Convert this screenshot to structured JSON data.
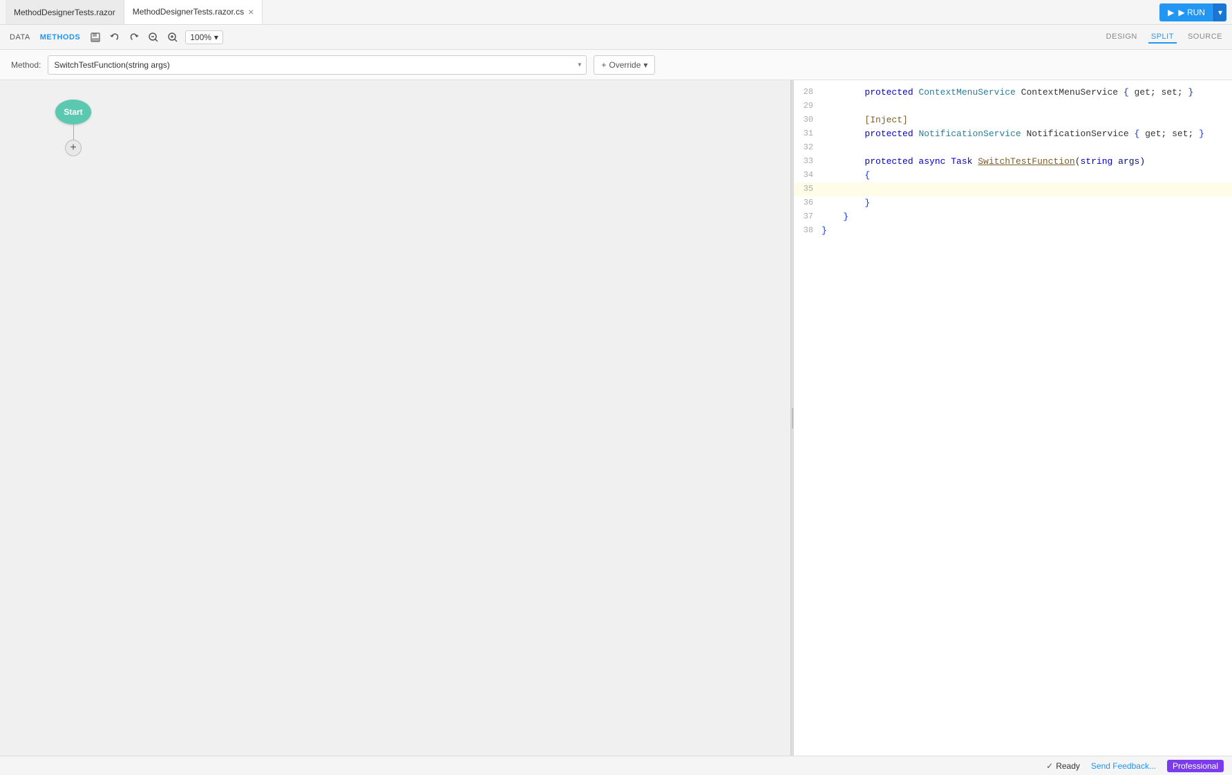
{
  "tabs": {
    "inactive_tab": {
      "label": "MethodDesignerTests.razor",
      "active": false
    },
    "active_tab": {
      "label": "MethodDesignerTests.razor.cs",
      "active": true
    }
  },
  "run_button": {
    "label": "▶ RUN"
  },
  "top_nav": {
    "data_tab": "DATA",
    "methods_tab": "METHODS"
  },
  "toolbar": {
    "zoom_level": "100%",
    "design_tab": "DESIGN",
    "split_tab": "SPLIT",
    "source_tab": "SOURCE"
  },
  "method_bar": {
    "label": "Method:",
    "selected_method": "SwitchTestFunction(string args)",
    "override_btn": "+ Override"
  },
  "designer": {
    "start_node_label": "Start",
    "add_btn_label": "+"
  },
  "code": {
    "lines": [
      {
        "num": "28",
        "tokens": [
          {
            "text": "        protected ",
            "class": "kw"
          },
          {
            "text": "ContextMenuService",
            "class": "type"
          },
          {
            "text": " ContextMenuService { get; set; }",
            "class": ""
          }
        ]
      },
      {
        "num": "29",
        "tokens": []
      },
      {
        "num": "30",
        "tokens": [
          {
            "text": "        [Inject]",
            "class": "attrib"
          }
        ]
      },
      {
        "num": "31",
        "tokens": [
          {
            "text": "        protected ",
            "class": "kw"
          },
          {
            "text": "NotificationService",
            "class": "type"
          },
          {
            "text": " NotificationService { get; set; }",
            "class": ""
          }
        ]
      },
      {
        "num": "32",
        "tokens": []
      },
      {
        "num": "33",
        "tokens": [
          {
            "text": "        protected async Task ",
            "class": "kw"
          },
          {
            "text": "SwitchTestFunction",
            "class": "method-name"
          },
          {
            "text": "(",
            "class": ""
          },
          {
            "text": "string",
            "class": "kw"
          },
          {
            "text": " args)",
            "class": "param"
          }
        ]
      },
      {
        "num": "34",
        "tokens": [
          {
            "text": "        {",
            "class": ""
          }
        ]
      },
      {
        "num": "35",
        "tokens": [],
        "highlighted": true
      },
      {
        "num": "36",
        "tokens": [
          {
            "text": "        }",
            "class": ""
          }
        ]
      },
      {
        "num": "37",
        "tokens": [
          {
            "text": "    }",
            "class": ""
          }
        ]
      },
      {
        "num": "38",
        "tokens": [
          {
            "text": "}",
            "class": ""
          }
        ]
      }
    ]
  },
  "status_bar": {
    "ready_label": "Ready",
    "feedback_label": "Send Feedback...",
    "professional_label": "Professional",
    "check_icon": "✓"
  }
}
